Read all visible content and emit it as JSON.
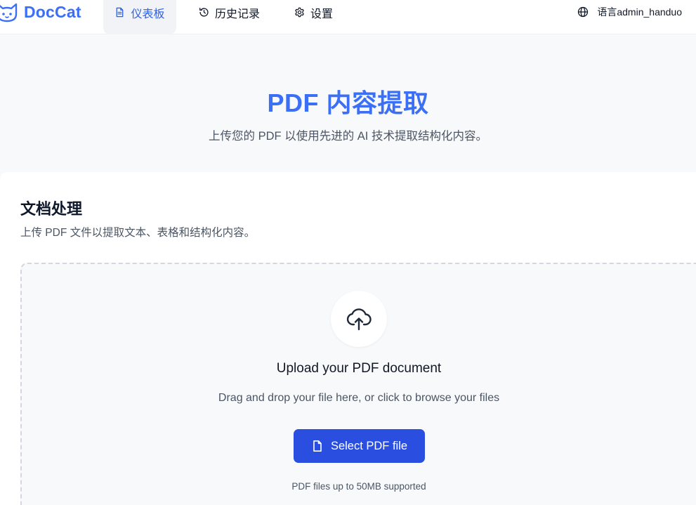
{
  "app": {
    "brand_name": "DocCat",
    "accent_color": "#3b6ff5",
    "primary_button_color": "#2a4fe0"
  },
  "nav": {
    "items": [
      {
        "label": "仪表板",
        "icon": "document-icon",
        "active": true
      },
      {
        "label": "历史记录",
        "icon": "history-icon",
        "active": false
      },
      {
        "label": "设置",
        "icon": "gear-icon",
        "active": false
      }
    ],
    "language_label": "语言",
    "username": "admin_handuo"
  },
  "hero": {
    "title": "PDF 内容提取",
    "subtitle": "上传您的 PDF 以使用先进的 AI 技术提取结构化内容。"
  },
  "card": {
    "title": "文档处理",
    "description": "上传 PDF 文件以提取文本、表格和结构化内容。"
  },
  "dropzone": {
    "icon": "cloud-upload-icon",
    "title": "Upload your PDF document",
    "hint": "Drag and drop your file here, or click to browse your files",
    "button_label": "Select PDF file",
    "button_icon": "file-icon",
    "footnote": "PDF files up to 50MB supported"
  }
}
